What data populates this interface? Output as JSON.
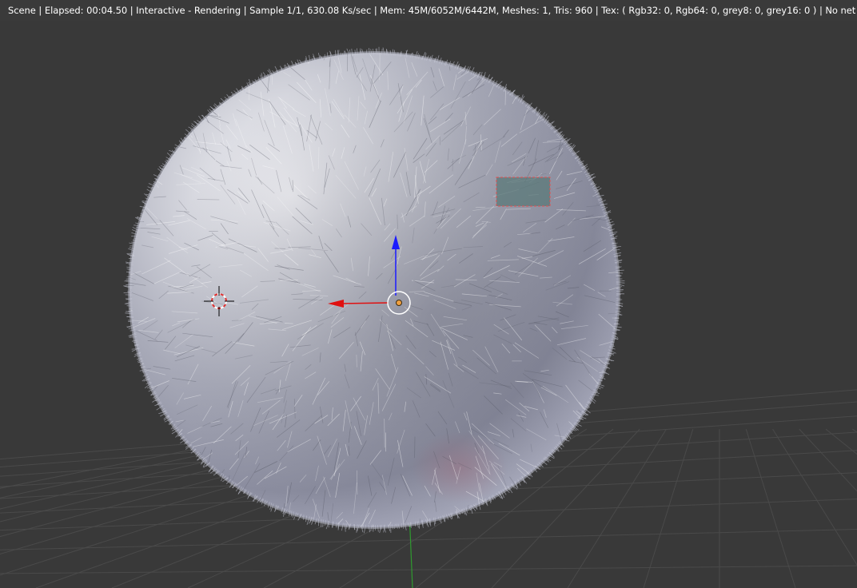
{
  "viewport": {
    "status_text": "Scene | Elapsed: 00:04.50 | Interactive - Rendering | Sample 1/1, 630.08 Ks/sec | Mem: 45M/6052M/6442M, Meshes: 1, Tris: 960 | Tex: ( Rgb32: 0, Rgb64: 0, grey8: 0, grey16: 0 ) | No net GPUs"
  },
  "colors": {
    "background": "#393939",
    "grid_line": "#4a4a4a",
    "y_axis_line": "#2f9a2f",
    "gizmo_z_arrow": "#1a1aff",
    "gizmo_x_arrow": "#e01010",
    "object_origin": "#f0a040",
    "cursor_ring": "#e03030",
    "lamp_border": "#e05050",
    "lamp_fill": "#5a7878",
    "sphere_light": "#f2f2f6",
    "sphere_dark": "#6a6c80"
  },
  "icons": {
    "cursor": "3d-cursor-icon",
    "origin": "object-origin-icon",
    "gizmo": "transform-gizmo-icon"
  }
}
